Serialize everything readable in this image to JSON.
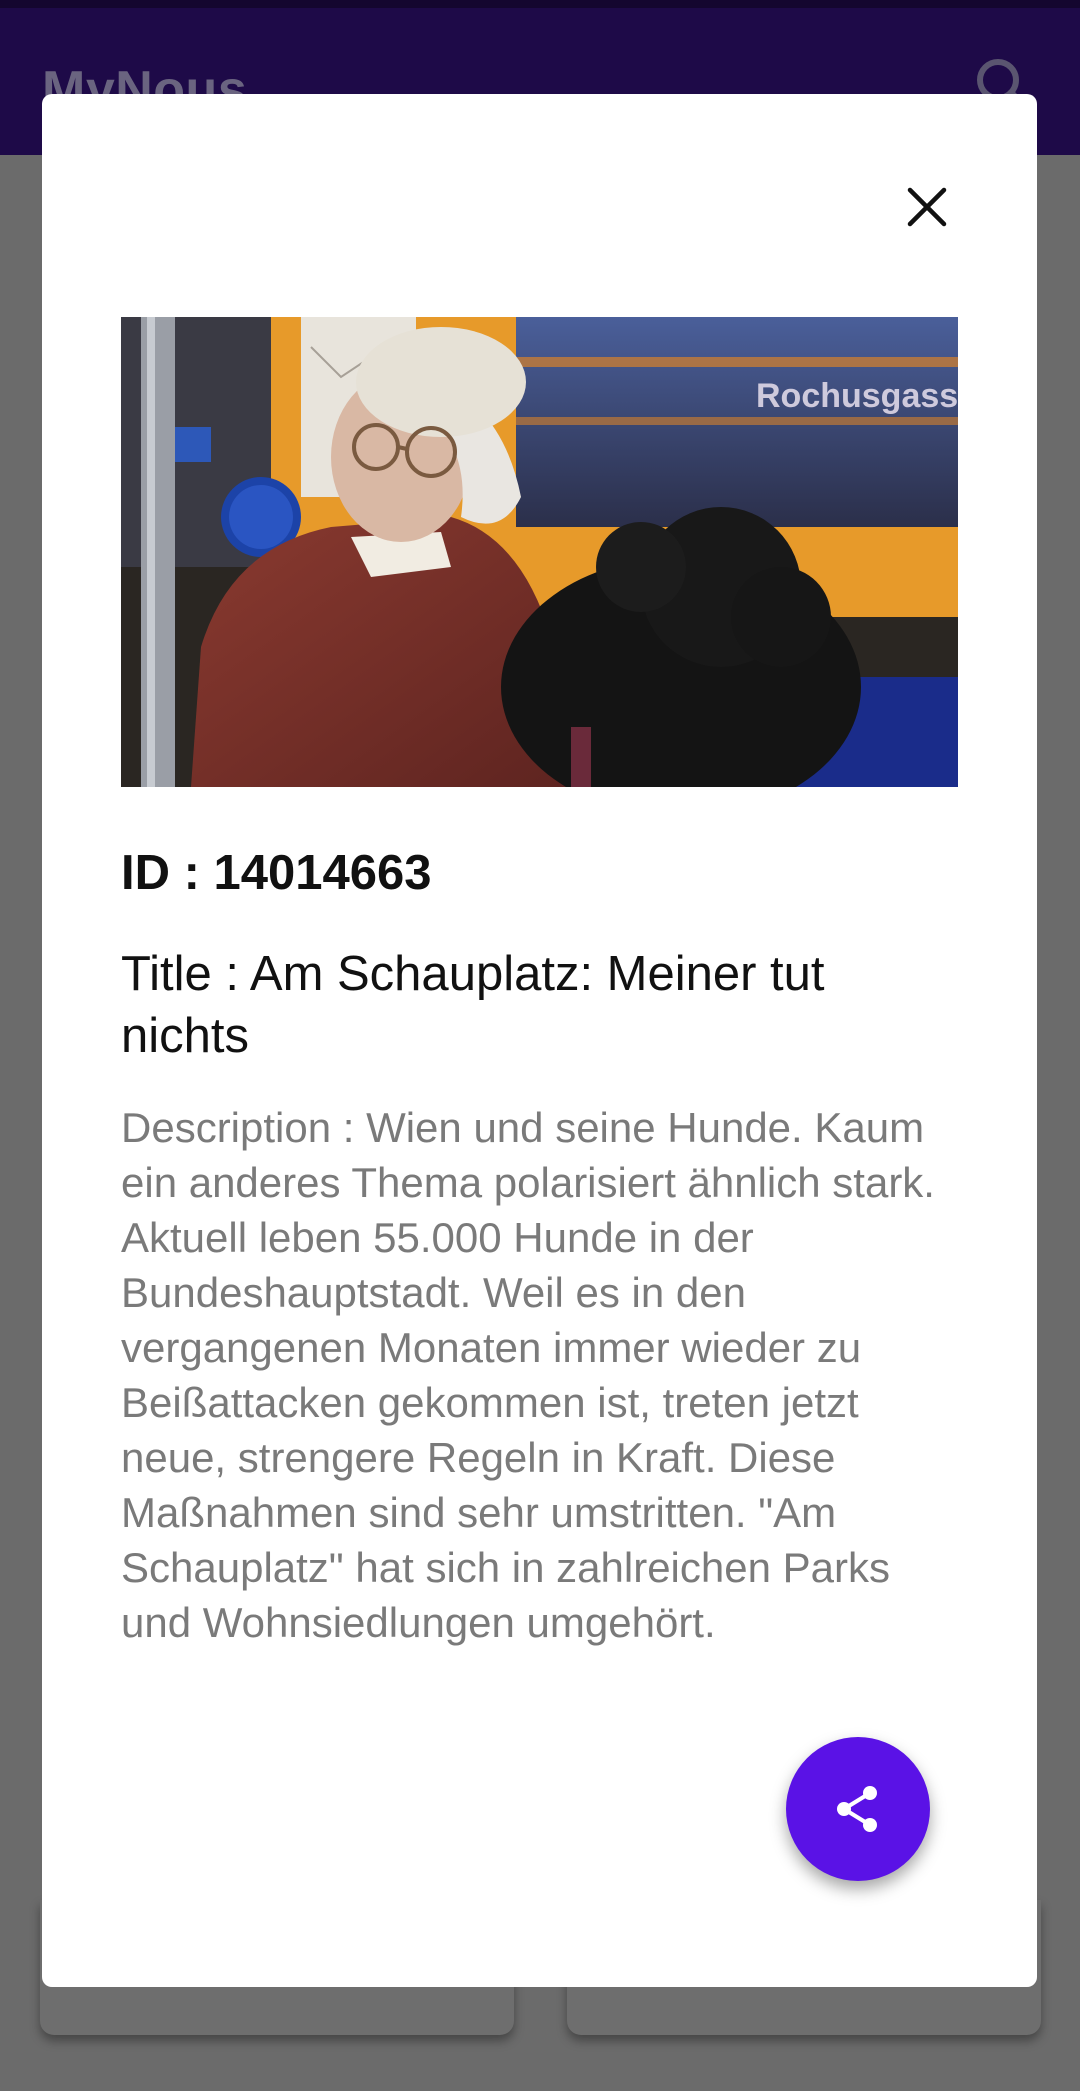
{
  "app_bar": {
    "title": "MyNous",
    "search_icon": "search-icon"
  },
  "dialog": {
    "close_icon": "close-icon",
    "id_text": "ID : 14014663",
    "title_text": "Title : Am Schauplatz: Meiner tut nichts",
    "description_text": "Description : Wien und seine Hunde. Kaum ein anderes Thema polarisiert ähnlich stark. Aktuell leben 55.000 Hunde in der Bundeshauptstadt. Weil es in den vergangenen Monaten immer wieder zu Beißattacken gekommen ist, treten jetzt neue, strengere Regeln in Kraft. Diese Maßnahmen sind sehr umstritten. \"Am Schauplatz\" hat sich in zahlreichen Parks und Wohnsiedlungen umgehört.",
    "thumbnail": {
      "sign_text": "Rochusgass"
    },
    "share_icon": "share-icon"
  },
  "colors": {
    "app_bar": "#1e0a48",
    "scrim": "#6b6b6b",
    "fab": "#5a12e6",
    "description": "#7a7a7a"
  }
}
